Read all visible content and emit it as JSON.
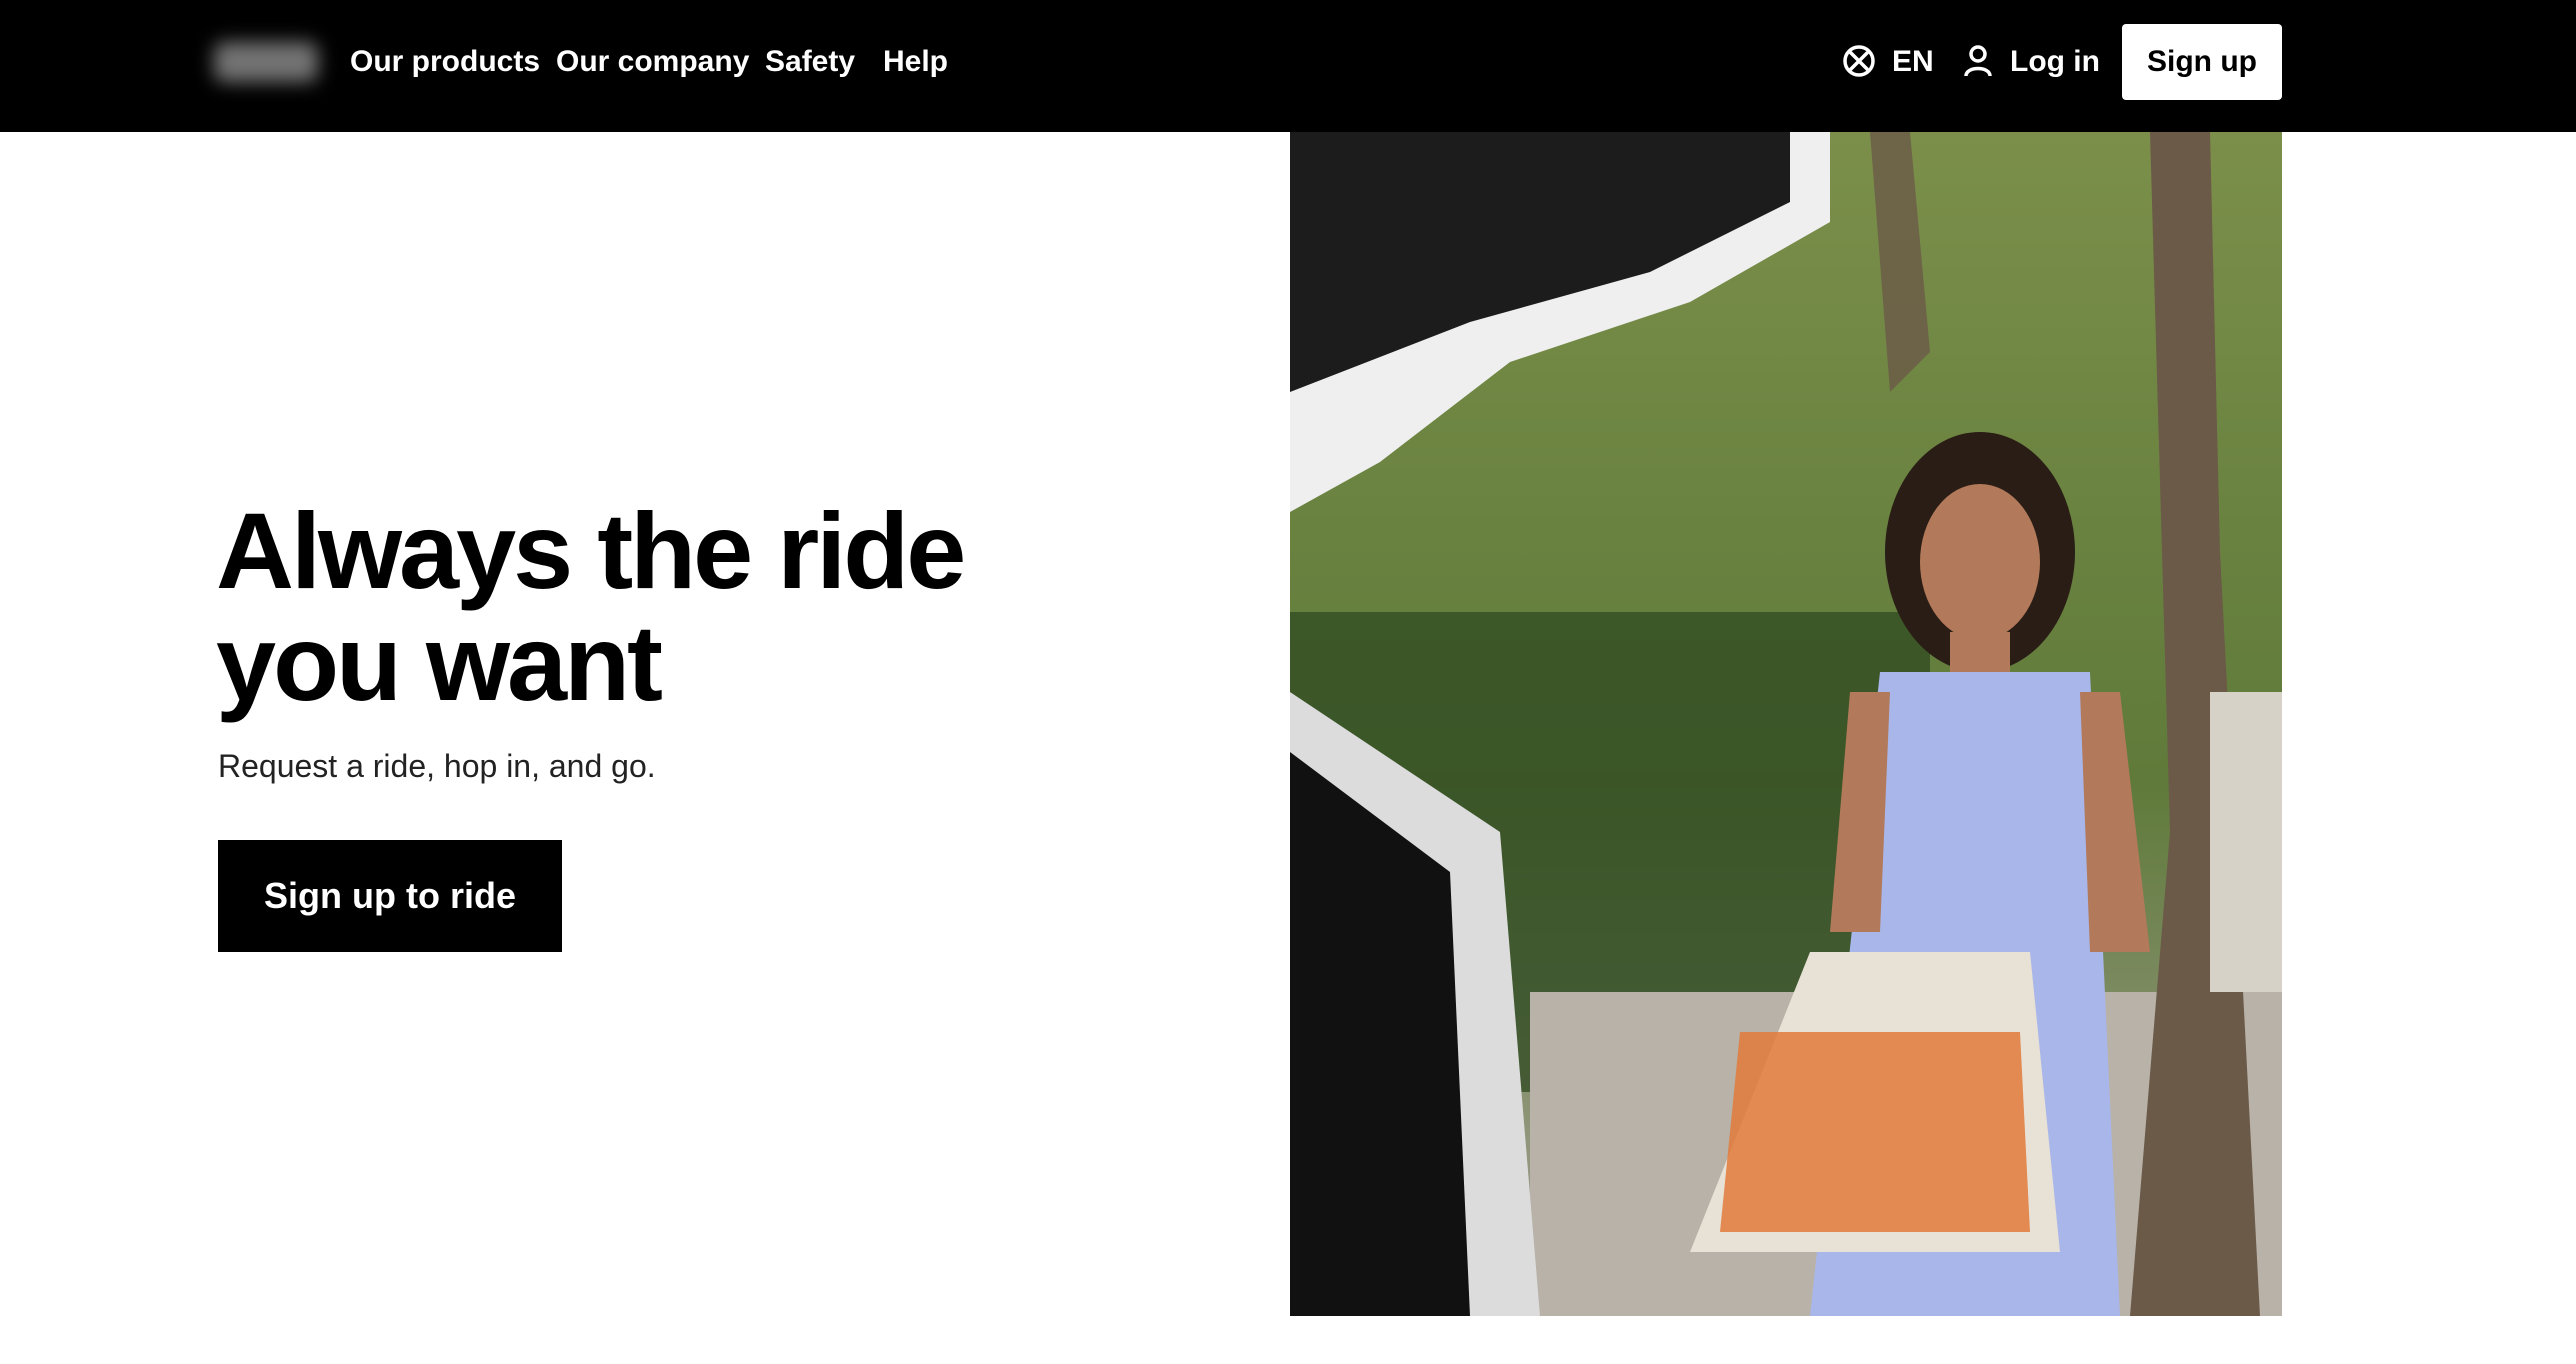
{
  "nav": {
    "logo_text": "Uber",
    "links": [
      "Our products",
      "Our company",
      "Safety",
      "Help"
    ],
    "language": "EN",
    "login": "Log in",
    "signup": "Sign up"
  },
  "hero": {
    "title": "Always the ride you want",
    "subtitle": "Request a ride, hop in, and go.",
    "cta": "Sign up to ride"
  },
  "icons": {
    "language": "globe-icon",
    "account": "user-icon"
  },
  "colors": {
    "nav_bg": "#000000",
    "cta_bg": "#000000",
    "page_bg": "#ffffff"
  }
}
